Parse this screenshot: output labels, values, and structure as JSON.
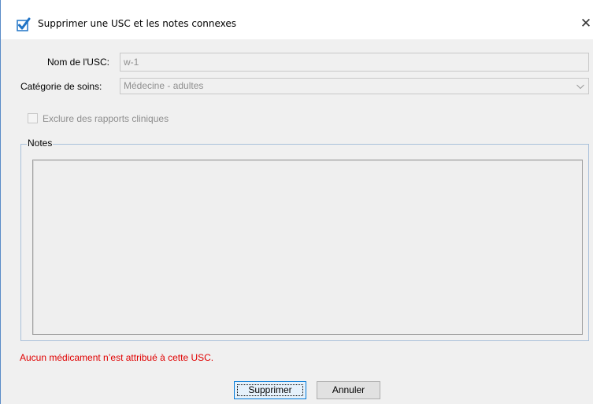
{
  "window": {
    "title": "Supprimer une USC et les notes connexes",
    "title_icon": "blue-checkmark-icon",
    "close_glyph": "✕"
  },
  "form": {
    "usc_name_label": "Nom de l'USC:",
    "usc_name_value": "w-1",
    "care_category_label": "Catégorie de soins:",
    "care_category_value": "Médecine - adultes",
    "exclude_label": "Exclure des rapports cliniques",
    "exclude_checked": false,
    "notes_legend": "Notes",
    "notes_value": ""
  },
  "warning": {
    "text": "Aucun médicament n’est attribué à cette USC.",
    "color": "#e00000"
  },
  "buttons": {
    "delete_label": "Supprimer",
    "cancel_label": "Annuler"
  },
  "colors": {
    "accent": "#1f73c6",
    "window_bg": "#f0f0f0",
    "disabled_text": "#8f8f8f"
  }
}
